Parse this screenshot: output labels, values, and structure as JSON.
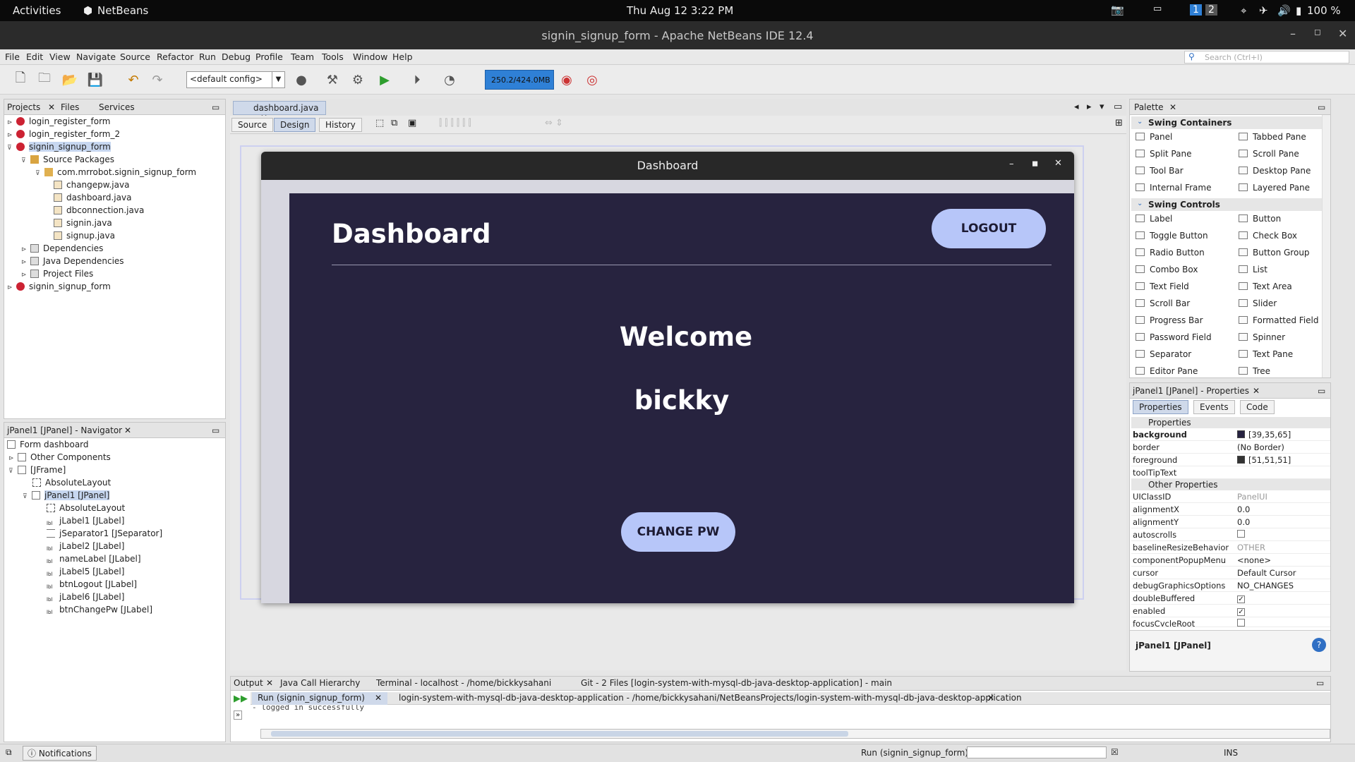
{
  "topbar": {
    "activities": "Activities",
    "app": "NetBeans",
    "clock": "Thu Aug 12  3:22 PM",
    "ws1": "1",
    "ws2": "2",
    "battery": "100 %"
  },
  "window": {
    "title": "signin_signup_form - Apache NetBeans IDE 12.4"
  },
  "menus": [
    "File",
    "Edit",
    "View",
    "Navigate",
    "Source",
    "Refactor",
    "Run",
    "Debug",
    "Profile",
    "Team",
    "Tools",
    "Window",
    "Help"
  ],
  "search": {
    "placeholder": "Search (Ctrl+I)"
  },
  "toolbar": {
    "config": "<default config>",
    "memory": "250.2/424.0MB"
  },
  "projects": {
    "tabs": [
      "Projects",
      "Files",
      "Services"
    ],
    "rows": [
      "login_register_form",
      "login_register_form_2",
      "signin_signup_form",
      "Source Packages",
      "com.mrrobot.signin_signup_form",
      "changepw.java",
      "dashboard.java",
      "dbconnection.java",
      "signin.java",
      "signup.java",
      "Dependencies",
      "Java Dependencies",
      "Project Files",
      "signin_signup_form"
    ]
  },
  "navigator": {
    "title": "jPanel1 [JPanel] - Navigator",
    "rows": [
      "Form dashboard",
      "Other Components",
      "[JFrame]",
      "AbsoluteLayout",
      "jPanel1 [JPanel]",
      "AbsoluteLayout",
      "jLabel1 [JLabel]",
      "jSeparator1 [JSeparator]",
      "jLabel2 [JLabel]",
      "nameLabel [JLabel]",
      "jLabel5 [JLabel]",
      "btnLogout [JLabel]",
      "jLabel6 [JLabel]",
      "btnChangePw [JLabel]"
    ]
  },
  "editor": {
    "tab": "dashboard.java",
    "views": [
      "Source",
      "Design",
      "History"
    ]
  },
  "dashboard": {
    "frame_title": "Dashboard",
    "heading": "Dashboard",
    "logout": "LOGOUT",
    "welcome": "Welcome",
    "username": "bickky",
    "change_pw": "CHANGE PW"
  },
  "palette": {
    "title": "Palette",
    "containers_head": "Swing Containers",
    "containers": [
      "Panel",
      "Tabbed Pane",
      "Split Pane",
      "Scroll Pane",
      "Tool Bar",
      "Desktop Pane",
      "Internal Frame",
      "Layered Pane"
    ],
    "controls_head": "Swing Controls",
    "controls": [
      "Label",
      "Button",
      "Toggle Button",
      "Check Box",
      "Radio Button",
      "Button Group",
      "Combo Box",
      "List",
      "Text Field",
      "Text Area",
      "Scroll Bar",
      "Slider",
      "Progress Bar",
      "Formatted Field",
      "Password Field",
      "Spinner",
      "Separator",
      "Text Pane",
      "Editor Pane",
      "Tree"
    ]
  },
  "properties": {
    "title": "jPanel1 [JPanel] - Properties",
    "tabs": [
      "Properties",
      "Events",
      "Code"
    ],
    "section1": "Properties",
    "section2": "Other Properties",
    "rows1": [
      {
        "name": "background",
        "value": "[39,35,65]",
        "color": "#272341"
      },
      {
        "name": "border",
        "value": "(No Border)"
      },
      {
        "name": "foreground",
        "value": "[51,51,51]",
        "color": "#333333"
      },
      {
        "name": "toolTipText",
        "value": ""
      }
    ],
    "rows2": [
      {
        "name": "UIClassID",
        "value": "PanelUI"
      },
      {
        "name": "alignmentX",
        "value": "0.0"
      },
      {
        "name": "alignmentY",
        "value": "0.0"
      },
      {
        "name": "autoscrolls",
        "value": ""
      },
      {
        "name": "baselineResizeBehavior",
        "value": "OTHER"
      },
      {
        "name": "componentPopupMenu",
        "value": "<none>"
      },
      {
        "name": "cursor",
        "value": "Default Cursor"
      },
      {
        "name": "debugGraphicsOptions",
        "value": "NO_CHANGES"
      },
      {
        "name": "doubleBuffered",
        "value": "✓"
      },
      {
        "name": "enabled",
        "value": "✓"
      },
      {
        "name": "focusCycleRoot",
        "value": ""
      }
    ],
    "footer": "jPanel1 [JPanel]"
  },
  "output": {
    "tabs": [
      "Output",
      "Java Call Hierarchy",
      "Terminal - localhost - /home/bickkysahani",
      "Git - 2 Files [login-system-with-mysql-db-java-desktop-application] - main"
    ],
    "subtab1": "Run (signin_signup_form)",
    "subtab2": "login-system-with-mysql-db-java-desktop-application - /home/bickkysahani/NetBeansProjects/login-system-with-mysql-db-java-desktop-application",
    "log": "- logged in successfully"
  },
  "status": {
    "notifications": "Notifications",
    "run": "Run (signin_signup_form)",
    "mode": "INS"
  },
  "colors": {
    "dash_bg": "#27233f",
    "pill": "#b7c6f9"
  }
}
